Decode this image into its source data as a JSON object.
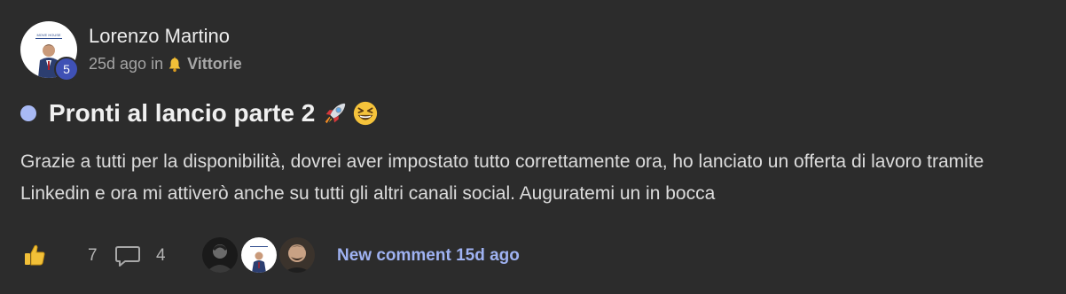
{
  "post": {
    "author": "Lorenzo Martino",
    "level": "5",
    "time_ago": "25d ago",
    "in_label": "in",
    "category": "Vittorie",
    "title": "Pronti al lancio parte 2",
    "body": "Grazie a tutti per la disponibilità, dovrei aver impostato tutto correttamente ora, ho lanciato un offerta di lavoro tramite Linkedin e ora mi attiverò anche su tutti gli altri canali social. Auguratemi un in bocca",
    "title_emojis": [
      "rocket-emoji",
      "grinning-squinting-face-emoji"
    ]
  },
  "footer": {
    "likes": "7",
    "comments": "4",
    "new_comment_label": "New comment 15d ago"
  },
  "colors": {
    "background": "#2c2c2c",
    "accent": "#9fb2f2",
    "unread_dot": "#a9baf5",
    "level_badge": "#3f51b5"
  },
  "icons": {
    "category": "bell-icon",
    "like": "thumbs-up-icon",
    "comment": "comment-bubble-icon"
  }
}
